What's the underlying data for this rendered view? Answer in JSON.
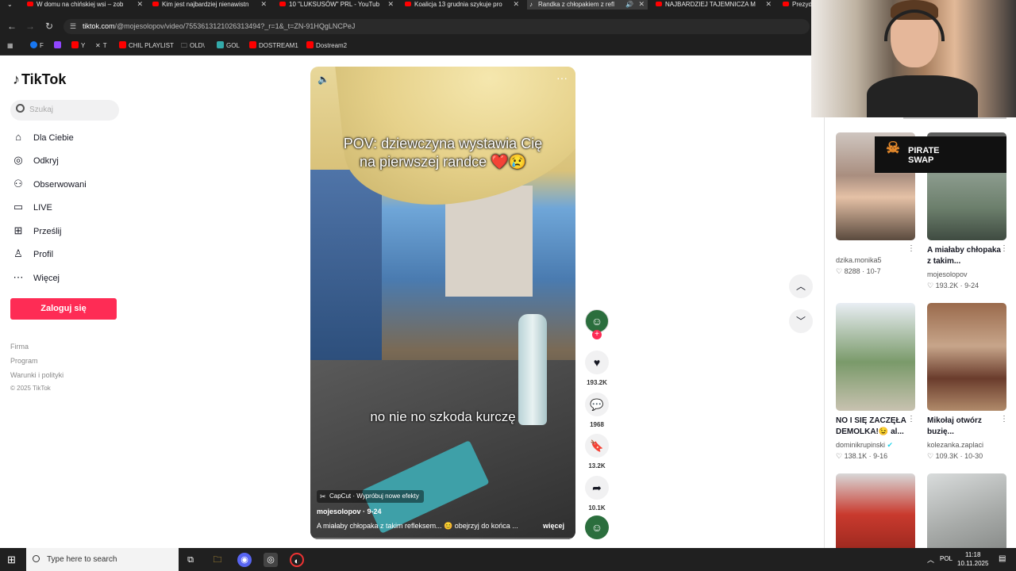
{
  "tabs": [
    {
      "label": "W domu na chińskiej wsi – zob",
      "active": false
    },
    {
      "label": "Kim jest najbardziej nienawistn",
      "active": false
    },
    {
      "label": "10 \"LUKSUSÓW\" PRL - YouTub",
      "active": false
    },
    {
      "label": "Koalicja 13 grudnia szykuje pro",
      "active": false
    },
    {
      "label": "Randka z chłopakiem z refl",
      "active": true
    },
    {
      "label": "NAJBARDZIEJ TAJEMNICZA M",
      "active": false
    },
    {
      "label": "Prezyd",
      "active": false
    }
  ],
  "address": {
    "host": "tiktok.com",
    "path": "/@mojesolopov/video/7553613121026313494?_r=1&_t=ZN-91HQgLNCPeJ"
  },
  "bookmarks": [
    "F",
    "",
    "Y",
    "T",
    "CHIL PLAYLIST",
    "OLD\\",
    "GOL",
    "DOSTREAM1",
    "Dostream2"
  ],
  "tiktok": {
    "logo": "TikTok",
    "search_placeholder": "Szukaj",
    "nav": [
      "Dla Ciebie",
      "Odkryj",
      "Obserwowani",
      "LIVE",
      "Prześlij",
      "Profil",
      "Więcej"
    ],
    "login": "Zaloguj się",
    "footer": [
      "Firma",
      "Program",
      "Warunki i polityki",
      "© 2025 TikTok"
    ]
  },
  "video": {
    "caption_line1": "POV: dziewczyna wystawia Cię",
    "caption_line2": "na pierwszej randce ❤️😢",
    "subtitle": "no nie no szkoda kurczę",
    "capcut": "CapCut · Wypróbuj nowe efekty",
    "author": "mojesolopov · 9-24",
    "description": "A miałaby chłopaka z takim refleksem... 😊 obejrzyj do końca ...",
    "more": "więcej"
  },
  "actions": {
    "likes": "193.2K",
    "comments": "1968",
    "saves": "13.2K",
    "shares": "10.1K"
  },
  "overlay": {
    "sponsor": "PIRATE\nSWAP"
  },
  "grid": [
    {
      "title": "",
      "author": "dzika.monika5",
      "likes": "8288",
      "date": "10-7"
    },
    {
      "title": "A miałaby chłopaka z takim...",
      "author": "mojesolopov",
      "likes": "193.2K",
      "date": "9-24"
    },
    {
      "title": "NO I SIĘ ZACZĘŁA DEMOLKA!😉 al...",
      "author": "dominikrupinski",
      "likes": "138.1K",
      "date": "9-16"
    },
    {
      "title": "Mikołaj otwórz buzię...",
      "author": "kolezanka.zaplaci",
      "likes": "109.3K",
      "date": "10-30"
    }
  ],
  "taskbar": {
    "search": "Type here to search",
    "lang": "POL",
    "time": "11:18",
    "date": "10.11.2025"
  },
  "colors": {
    "accent": "#fe2c55",
    "chrome": "#1f1f1f"
  }
}
